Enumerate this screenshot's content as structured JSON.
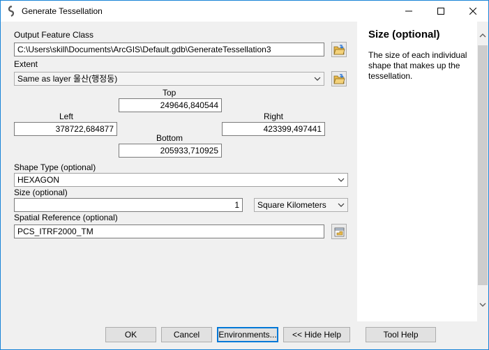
{
  "window": {
    "title": "Generate Tessellation",
    "controls": {
      "minimize_icon": "minimize-icon",
      "maximize_icon": "maximize-icon",
      "close_icon": "close-icon"
    }
  },
  "form": {
    "output_feature_class": {
      "label": "Output Feature Class",
      "value": "C:\\Users\\skill\\Documents\\ArcGIS\\Default.gdb\\GenerateTessellation3"
    },
    "extent": {
      "label": "Extent",
      "value": "Same as layer 울산(행정동)",
      "top_label": "Top",
      "top_value": "249646,840544",
      "left_label": "Left",
      "left_value": "378722,684877",
      "right_label": "Right",
      "right_value": "423399,497441",
      "bottom_label": "Bottom",
      "bottom_value": "205933,710925"
    },
    "shape_type": {
      "label": "Shape Type (optional)",
      "value": "HEXAGON"
    },
    "size": {
      "label": "Size (optional)",
      "value": "1",
      "unit": "Square Kilometers"
    },
    "spatial_reference": {
      "label": "Spatial Reference (optional)",
      "value": "PCS_ITRF2000_TM"
    }
  },
  "help": {
    "title": "Size (optional)",
    "body": "The size of each individual shape that makes up the tessellation."
  },
  "buttons": {
    "ok": "OK",
    "cancel": "Cancel",
    "environments": "Environments...",
    "hide_help": "<< Hide Help",
    "tool_help": "Tool Help"
  },
  "colors": {
    "accent": "#0078d7",
    "folder": "#e8b84a"
  }
}
